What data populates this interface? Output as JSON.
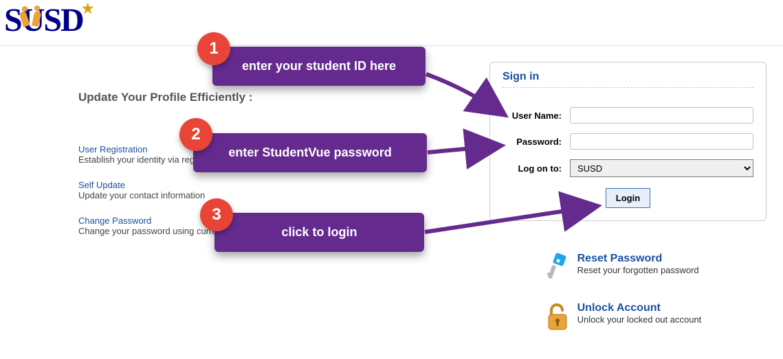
{
  "logo": {
    "text": "SUSD"
  },
  "heading": "Update Your Profile Efficiently :",
  "side_links": [
    {
      "label": "User Registration",
      "desc": "Establish your identity via registration"
    },
    {
      "label": "Self Update",
      "desc": "Update your contact information"
    },
    {
      "label": "Change Password",
      "desc": "Change your password using current password"
    }
  ],
  "signin": {
    "title": "Sign in",
    "username_label": "User Name:",
    "username_value": "",
    "password_label": "Password:",
    "password_value": "",
    "logon_label": "Log on to:",
    "logon_options": [
      "SUSD"
    ],
    "logon_selected": "SUSD",
    "login_button": "Login"
  },
  "help": {
    "reset": {
      "label": "Reset Password",
      "desc": "Reset your forgotten password"
    },
    "unlock": {
      "label": "Unlock Account",
      "desc": "Unlock your locked out account"
    }
  },
  "annotations": {
    "step1": {
      "num": "1",
      "text": "enter your student ID here"
    },
    "step2": {
      "num": "2",
      "text": "enter StudentVue password"
    },
    "step3": {
      "num": "3",
      "text": "click to login"
    }
  }
}
